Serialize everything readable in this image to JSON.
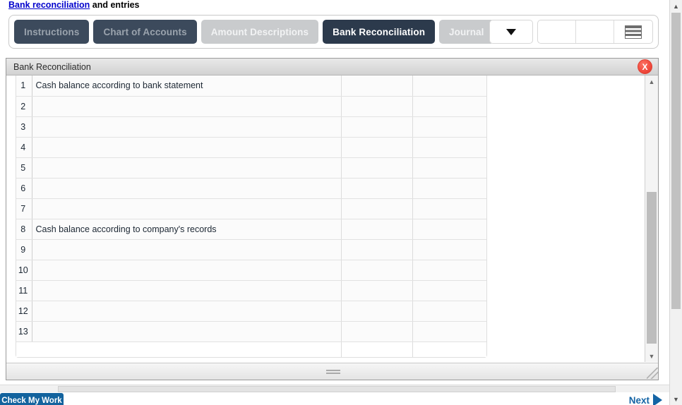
{
  "heading": {
    "link_text": "Bank reconciliation",
    "rest_text": " and entries"
  },
  "tabs": [
    {
      "label": "Instructions",
      "state": "dark"
    },
    {
      "label": "Chart of Accounts",
      "state": "dark"
    },
    {
      "label": "Amount Descriptions",
      "state": "light"
    },
    {
      "label": "Bank Reconciliation",
      "state": "active"
    },
    {
      "label": "Journal",
      "state": "light"
    }
  ],
  "toolbar": {
    "dropdown_icon": "chevron-down-icon",
    "menu_icon": "list-menu-icon"
  },
  "panel": {
    "title": "Bank Reconciliation",
    "close_label": "X"
  },
  "sheet": {
    "rows": [
      {
        "num": "1",
        "label": "Cash balance according to bank statement",
        "amount1": "",
        "amount2": ""
      },
      {
        "num": "2",
        "label": "",
        "amount1": "",
        "amount2": ""
      },
      {
        "num": "3",
        "label": "",
        "amount1": "",
        "amount2": ""
      },
      {
        "num": "4",
        "label": "",
        "amount1": "",
        "amount2": ""
      },
      {
        "num": "5",
        "label": "",
        "amount1": "",
        "amount2": ""
      },
      {
        "num": "6",
        "label": "",
        "amount1": "",
        "amount2": ""
      },
      {
        "num": "7",
        "label": "",
        "amount1": "",
        "amount2": ""
      },
      {
        "num": "8",
        "label": "Cash balance according to company's records",
        "amount1": "",
        "amount2": ""
      },
      {
        "num": "9",
        "label": "",
        "amount1": "",
        "amount2": ""
      },
      {
        "num": "10",
        "label": "",
        "amount1": "",
        "amount2": ""
      },
      {
        "num": "11",
        "label": "",
        "amount1": "",
        "amount2": ""
      },
      {
        "num": "12",
        "label": "",
        "amount1": "",
        "amount2": ""
      },
      {
        "num": "13",
        "label": "",
        "amount1": "",
        "amount2": ""
      }
    ]
  },
  "footer": {
    "check_label": "Check My Work",
    "next_label": "Next"
  },
  "colors": {
    "link": "#0000cc",
    "tab_dark": "#3c4a5c",
    "tab_active": "#2c3a4c",
    "tab_light": "#c9cbcd",
    "accent_blue": "#13639e",
    "close_red": "#f0483b"
  }
}
